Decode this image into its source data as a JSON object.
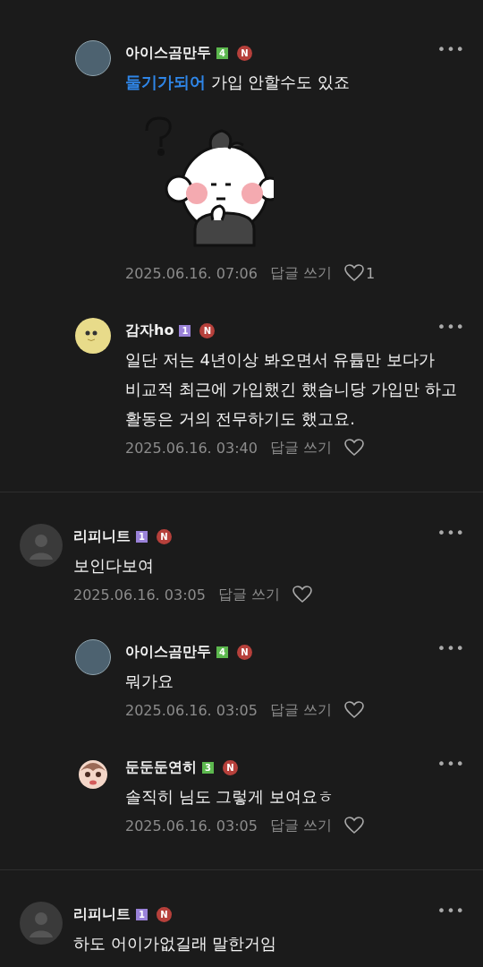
{
  "comments": [
    {
      "reply": true,
      "avatar": {
        "kind": "photo"
      },
      "name": "아이스곰만두",
      "level": {
        "text": "4",
        "color": "#5cb84e"
      },
      "badge": "N",
      "more": "•••",
      "mention": "둘기가되어",
      "text": "가입 안할수도 있죠",
      "sticker": true,
      "date": "2025.06.16. 07:06",
      "reply_label": "답글 쓰기",
      "likes": "1",
      "divider_after": false
    },
    {
      "reply": true,
      "avatar": {
        "kind": "sticker"
      },
      "name": "감자ho",
      "level": {
        "text": "1",
        "color": "#9a82d8"
      },
      "badge": "N",
      "more": "•••",
      "text": "일단 저는 4년이상 봐오면서 유튭만 보다가 비교적 최근에 가입했긴 했습니당 가입만 하고 활동은 거의 전무하기도 했고요.",
      "sticker": false,
      "date": "2025.06.16. 03:40",
      "reply_label": "답글 쓰기",
      "divider_after": true
    },
    {
      "reply": false,
      "avatar": {
        "kind": "default"
      },
      "name": "리피니트",
      "level": {
        "text": "1",
        "color": "#9a82d8"
      },
      "badge": "N",
      "more": "•••",
      "text": "보인다보여",
      "sticker": false,
      "date": "2025.06.16. 03:05",
      "reply_label": "답글 쓰기",
      "divider_after": false
    },
    {
      "reply": true,
      "avatar": {
        "kind": "photo"
      },
      "name": "아이스곰만두",
      "level": {
        "text": "4",
        "color": "#5cb84e"
      },
      "badge": "N",
      "more": "•••",
      "text": "뭐가요",
      "sticker": false,
      "date": "2025.06.16. 03:05",
      "reply_label": "답글 쓰기",
      "divider_after": false
    },
    {
      "reply": true,
      "avatar": {
        "kind": "character"
      },
      "name": "둔둔둔연히",
      "level": {
        "text": "3",
        "color": "#5cb84e"
      },
      "badge": "N",
      "more": "•••",
      "text": "솔직히 님도 그렇게 보여요ㅎ",
      "sticker": false,
      "date": "2025.06.16. 03:05",
      "reply_label": "답글 쓰기",
      "divider_after": true
    },
    {
      "reply": false,
      "avatar": {
        "kind": "default"
      },
      "name": "리피니트",
      "level": {
        "text": "1",
        "color": "#9a82d8"
      },
      "badge": "N",
      "more": "•••",
      "text": "하도 어이가없길래 말한거임",
      "sticker": false,
      "divider_after": false
    }
  ]
}
